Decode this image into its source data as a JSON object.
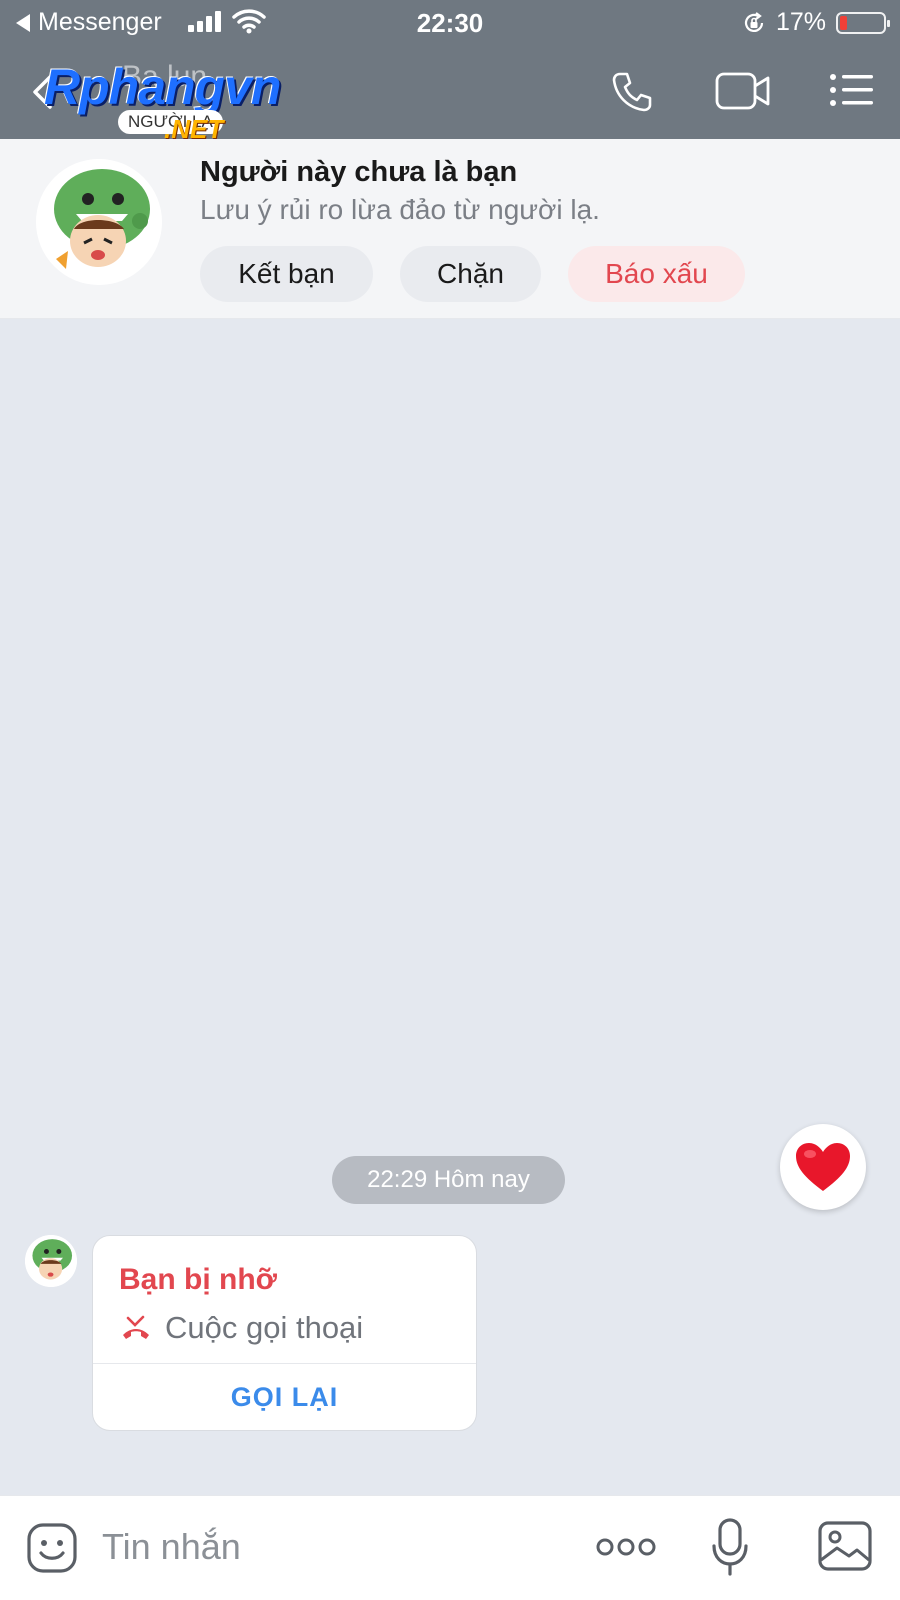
{
  "status_bar": {
    "back_app": "Messenger",
    "time": "22:30",
    "battery_percent": "17%",
    "battery_level": 0.17,
    "icons": [
      "signal-icon",
      "wifi-icon",
      "rotation-lock-icon",
      "battery-icon"
    ]
  },
  "header": {
    "contact_name": "Ba lun",
    "watermark": {
      "brand": "Rphangvn",
      "suffix": ".NET",
      "pill": "NGƯỜI LẠ"
    },
    "icons": [
      "back-chevron-icon",
      "phone-icon",
      "video-camera-icon",
      "menu-list-icon"
    ]
  },
  "stranger_banner": {
    "title": "Người này chưa là bạn",
    "subtitle": "Lưu ý rủi ro lừa đảo từ người lạ.",
    "buttons": {
      "add_friend": "Kết bạn",
      "block": "Chặn",
      "report": "Báo xấu"
    }
  },
  "chat": {
    "timestamp": "22:29 Hôm nay",
    "missed_call": {
      "title": "Bạn bị nhỡ",
      "call_type": "Cuộc gọi thoại",
      "action": "GỌI LẠI"
    }
  },
  "composer": {
    "placeholder": "Tin nhắn",
    "icons": [
      "sticker-icon",
      "more-dots-icon",
      "microphone-icon",
      "image-icon"
    ]
  },
  "colors": {
    "header_bg": "#6f7881",
    "chat_bg": "#e4e8ef",
    "danger": "#e2474f",
    "link": "#3b8bea"
  }
}
